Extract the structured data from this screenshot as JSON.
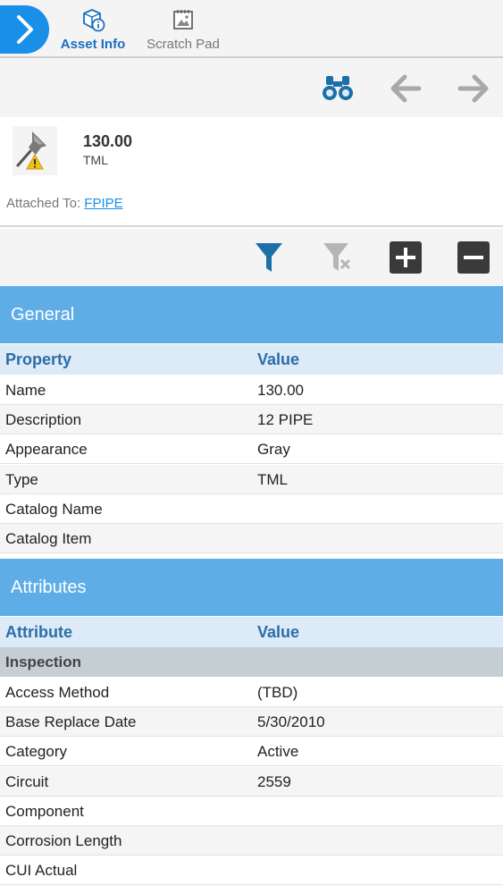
{
  "tabs": [
    {
      "label": "Asset Info",
      "icon": "asset-info-icon",
      "active": true
    },
    {
      "label": "Scratch Pad",
      "icon": "scratch-pad-icon",
      "active": false
    }
  ],
  "asset": {
    "name": "130.00",
    "type": "TML",
    "attached_label": "Attached To:",
    "attached_link": "FPIPE"
  },
  "general": {
    "title": "General",
    "headers": {
      "property": "Property",
      "value": "Value"
    },
    "rows": [
      {
        "property": "Name",
        "value": "130.00"
      },
      {
        "property": "Description",
        "value": "12 PIPE"
      },
      {
        "property": "Appearance",
        "value": "Gray"
      },
      {
        "property": "Type",
        "value": "TML"
      },
      {
        "property": "Catalog Name",
        "value": ""
      },
      {
        "property": "Catalog Item",
        "value": ""
      }
    ]
  },
  "attributes": {
    "title": "Attributes",
    "headers": {
      "attribute": "Attribute",
      "value": "Value"
    },
    "group": "Inspection",
    "rows": [
      {
        "attribute": "Access Method",
        "value": "(TBD)"
      },
      {
        "attribute": "Base Replace Date",
        "value": "5/30/2010"
      },
      {
        "attribute": "Category",
        "value": "Active"
      },
      {
        "attribute": "Circuit",
        "value": "2559"
      },
      {
        "attribute": "Component",
        "value": ""
      },
      {
        "attribute": "Corrosion Length",
        "value": ""
      },
      {
        "attribute": "CUI Actual",
        "value": ""
      }
    ]
  },
  "colors": {
    "accent": "#1a8fe8",
    "section": "#5fade6",
    "header_row": "#dcebf7",
    "group_row": "#c5ced3",
    "nav_icon": "#1d6fa8",
    "dark_button": "#3a3a3a"
  }
}
